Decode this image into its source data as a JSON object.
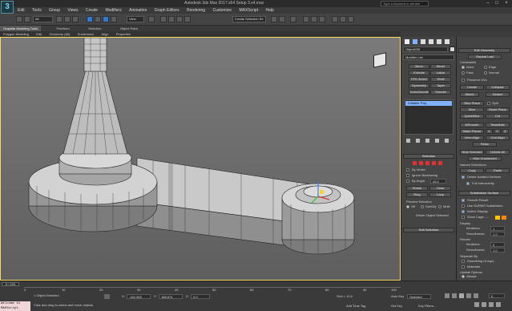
{
  "window": {
    "title": "Autodesk 3ds Max 2017.x64    Setup 3.x4.max",
    "search_placeholder": "Type a keyword or phrase",
    "logo_letter": "3"
  },
  "menu": [
    "Edit",
    "Tools",
    "Group",
    "Views",
    "Create",
    "Modifiers",
    "Animation",
    "Graph Editors",
    "Rendering",
    "Customize",
    "MAXScript",
    "Help"
  ],
  "toolbar": {
    "selection_filter": "All",
    "view_dropdown": "View",
    "named_selection": "Create Selection Se"
  },
  "ribbon": {
    "tabs": [
      "Graphite Modeling Tools",
      "Freeform",
      "Selection",
      "Object Paint"
    ],
    "active_tab": "Graphite Modeling Tools",
    "subtabs": [
      "Polygon Modeling",
      "Edit",
      "Geometry (All)",
      "Subdivision",
      "Align",
      "Properties"
    ]
  },
  "viewport": {
    "label": "[ + ] [ Perspective ] [ Shaded + Edged Faces ]",
    "gizmo_label": "ViewCube"
  },
  "command_panel": {
    "object_name": "Object035",
    "modifier_list": "Modifier List",
    "buttons": [
      [
        "Bend",
        "Bevel"
      ],
      [
        "Extrude",
        "Lathe"
      ],
      [
        "FFD 3x3x3",
        "Shell"
      ],
      [
        "Symmetry",
        "Taper"
      ],
      [
        "TurboSmooth",
        "Smooth"
      ]
    ],
    "stack_item": "Editable Poly",
    "selection_rollout": "Selection",
    "by_vertex": "By Vertex",
    "ignore_backfacing": "Ignore Backfacing",
    "by_angle": "By Angle:",
    "by_angle_value": "45.0",
    "shrink": "Shrink",
    "grow": "Grow",
    "ring": "Ring",
    "loop": "Loop",
    "preview_selection": "Preview Selection",
    "preview_options": [
      "Off",
      "SubObj",
      "Multi"
    ],
    "whole_object_selected": "Whole Object Selected",
    "soft_selection": "Soft Selection"
  },
  "edit_geometry": {
    "header": "Edit Geometry",
    "repeat_last": "Repeat Last",
    "constraints": "Constraints",
    "constraint_options": [
      [
        "None",
        "Edge"
      ],
      [
        "Face",
        "Normal"
      ]
    ],
    "preserve_uvs": "Preserve UVs",
    "create": "Create",
    "collapse": "Collapse",
    "attach": "Attach",
    "detach": "Detach",
    "slice_plane": "Slice Plane",
    "split": "Split",
    "slice": "Slice",
    "reset_plane": "Reset Plane",
    "quickslice": "QuickSlice",
    "cut": "Cut",
    "msmooth": "MSmooth",
    "tessellate": "Tessellate",
    "make_planar": "Make Planar",
    "x": "X",
    "y": "Y",
    "z": "Z",
    "view_align": "View Align",
    "grid_align": "Grid Align",
    "relax": "Relax",
    "hide_selected": "Hide Selected",
    "unhide_all": "Unhide All",
    "hide_unselected": "Hide Unselected",
    "named_selections": "Named Selections:",
    "copy": "Copy",
    "paste": "Paste",
    "delete_isolated": "Delete Isolated Vertices",
    "full_interactivity": "Full Interactivity",
    "subdivision_surface": "Subdivision Surface",
    "smooth_result": "Smooth Result",
    "use_nurms": "Use NURMS Subdivision",
    "isoline_display": "Isoline Display",
    "show_cage": "Show Cage......",
    "display": "Display",
    "iterations": "Iterations:",
    "iterations_value": "1",
    "smoothness": "Smoothness:",
    "smoothness_value": "1.0",
    "render": "Render",
    "render_iterations_value": "0",
    "render_smoothness_value": "1.0",
    "separate_by": "Separate By",
    "smoothing_groups": "Smoothing Groups",
    "materials": "Materials",
    "update_options": "Update Options",
    "always": "Always",
    "when_rendering": "When Rendering",
    "manually": "Manually"
  },
  "timeline": {
    "frame_display": "0 / 100",
    "ticks": [
      "0",
      "5",
      "10",
      "15",
      "20",
      "25",
      "30",
      "35",
      "40",
      "45",
      "50",
      "55",
      "60",
      "65",
      "70",
      "75",
      "80",
      "85",
      "90",
      "95",
      "100"
    ]
  },
  "status": {
    "maxscript": "Welcome to MAXScript.",
    "selected": "1 Object Selected",
    "prompt": "Click and drag to select and move objects",
    "x_label": "X:",
    "x_value": "-162.963",
    "y_label": "Y:",
    "y_value": "188.674",
    "z_label": "Z:",
    "z_value": "0.0",
    "grid": "Grid = 10.0",
    "add_time_tag": "Add Time Tag",
    "auto_key": "Auto Key",
    "selected_dropdown": "Selected",
    "set_key": "Set Key",
    "key_filters": "Key Filters...",
    "frame_value": "0"
  },
  "colors": {
    "viewport_bg": "#6b6b6b",
    "active_border": "#ffd75e",
    "stack_highlight": "#7fb3ff",
    "cage_yellow": "#ffc400",
    "cage_orange": "#ff8a00"
  }
}
